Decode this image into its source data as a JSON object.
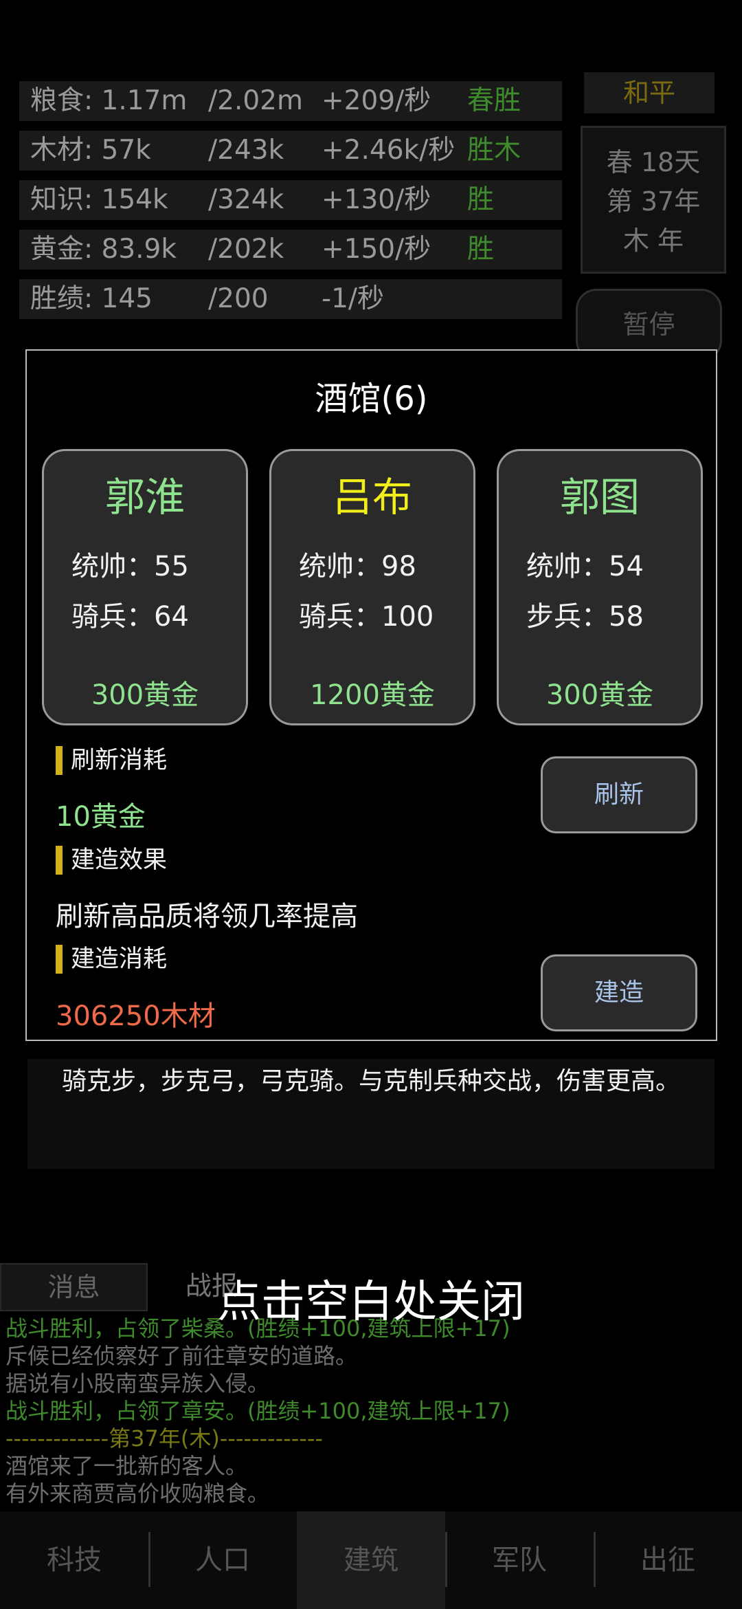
{
  "resources": [
    {
      "name": "粮食: 1.17m",
      "max": "/2.02m",
      "rate": "+209/秒",
      "tag": "春胜"
    },
    {
      "name": "木材: 57k",
      "max": "/243k",
      "rate": "+2.46k/秒",
      "tag": "胜木"
    },
    {
      "name": "知识: 154k",
      "max": "/324k",
      "rate": "+130/秒",
      "tag": "胜"
    },
    {
      "name": "黄金: 83.9k",
      "max": "/202k",
      "rate": "+150/秒",
      "tag": "胜"
    },
    {
      "name": "胜绩: 145",
      "max": "/200",
      "rate": "-1/秒",
      "tag": ""
    }
  ],
  "status": {
    "peace": "和平",
    "season_day": "春 18天",
    "year": "第 37年",
    "element_year": "木 年",
    "pause": "暂停"
  },
  "modal": {
    "title": "酒馆(6)",
    "cards": [
      {
        "name": "郭淮",
        "name_color": "#8fe38f",
        "stat1": "统帅：55",
        "stat2": "骑兵：64",
        "price": "300黄金"
      },
      {
        "name": "吕布",
        "name_color": "#f2ee1a",
        "stat1": "统帅：98",
        "stat2": "骑兵：100",
        "price": "1200黄金"
      },
      {
        "name": "郭图",
        "name_color": "#8fe38f",
        "stat1": "统帅：54",
        "stat2": "步兵：58",
        "price": "300黄金"
      }
    ],
    "refresh_cost_label": "刷新消耗",
    "refresh_cost_value": "10黄金",
    "build_effect_label": "建造效果",
    "build_effect_value": "刷新高品质将领几率提高",
    "build_cost_label": "建造消耗",
    "build_cost_value": "306250木材",
    "refresh_button": "刷新",
    "build_button": "建造",
    "value_green": "#8fe38f",
    "value_red": "#f06a4a"
  },
  "hint": "骑克步，步克弓，弓克骑。与克制兵种交战，伤害更高。",
  "close_hint": "点击空白处关闭",
  "tabs": {
    "messages": "消息",
    "battle": "战报"
  },
  "log": [
    {
      "text": "战斗胜利，占领了柴桑。(胜绩+100,建筑上限+17)",
      "style": "green"
    },
    {
      "text": "斥候已经侦察好了前往章安的道路。",
      "style": "gray"
    },
    {
      "text": "据说有小股南蛮异族入侵。",
      "style": "gray"
    },
    {
      "text": "战斗胜利，占领了章安。(胜绩+100,建筑上限+17)",
      "style": "green"
    },
    {
      "text": "-------------第37年(木)-------------",
      "style": "olive"
    },
    {
      "text": "酒馆来了一批新的客人。",
      "style": "gray"
    },
    {
      "text": "有外来商贾高价收购粮食。",
      "style": "gray"
    }
  ],
  "nav": [
    "科技",
    "人口",
    "建筑",
    "军队",
    "出征"
  ],
  "nav_active_index": 2
}
